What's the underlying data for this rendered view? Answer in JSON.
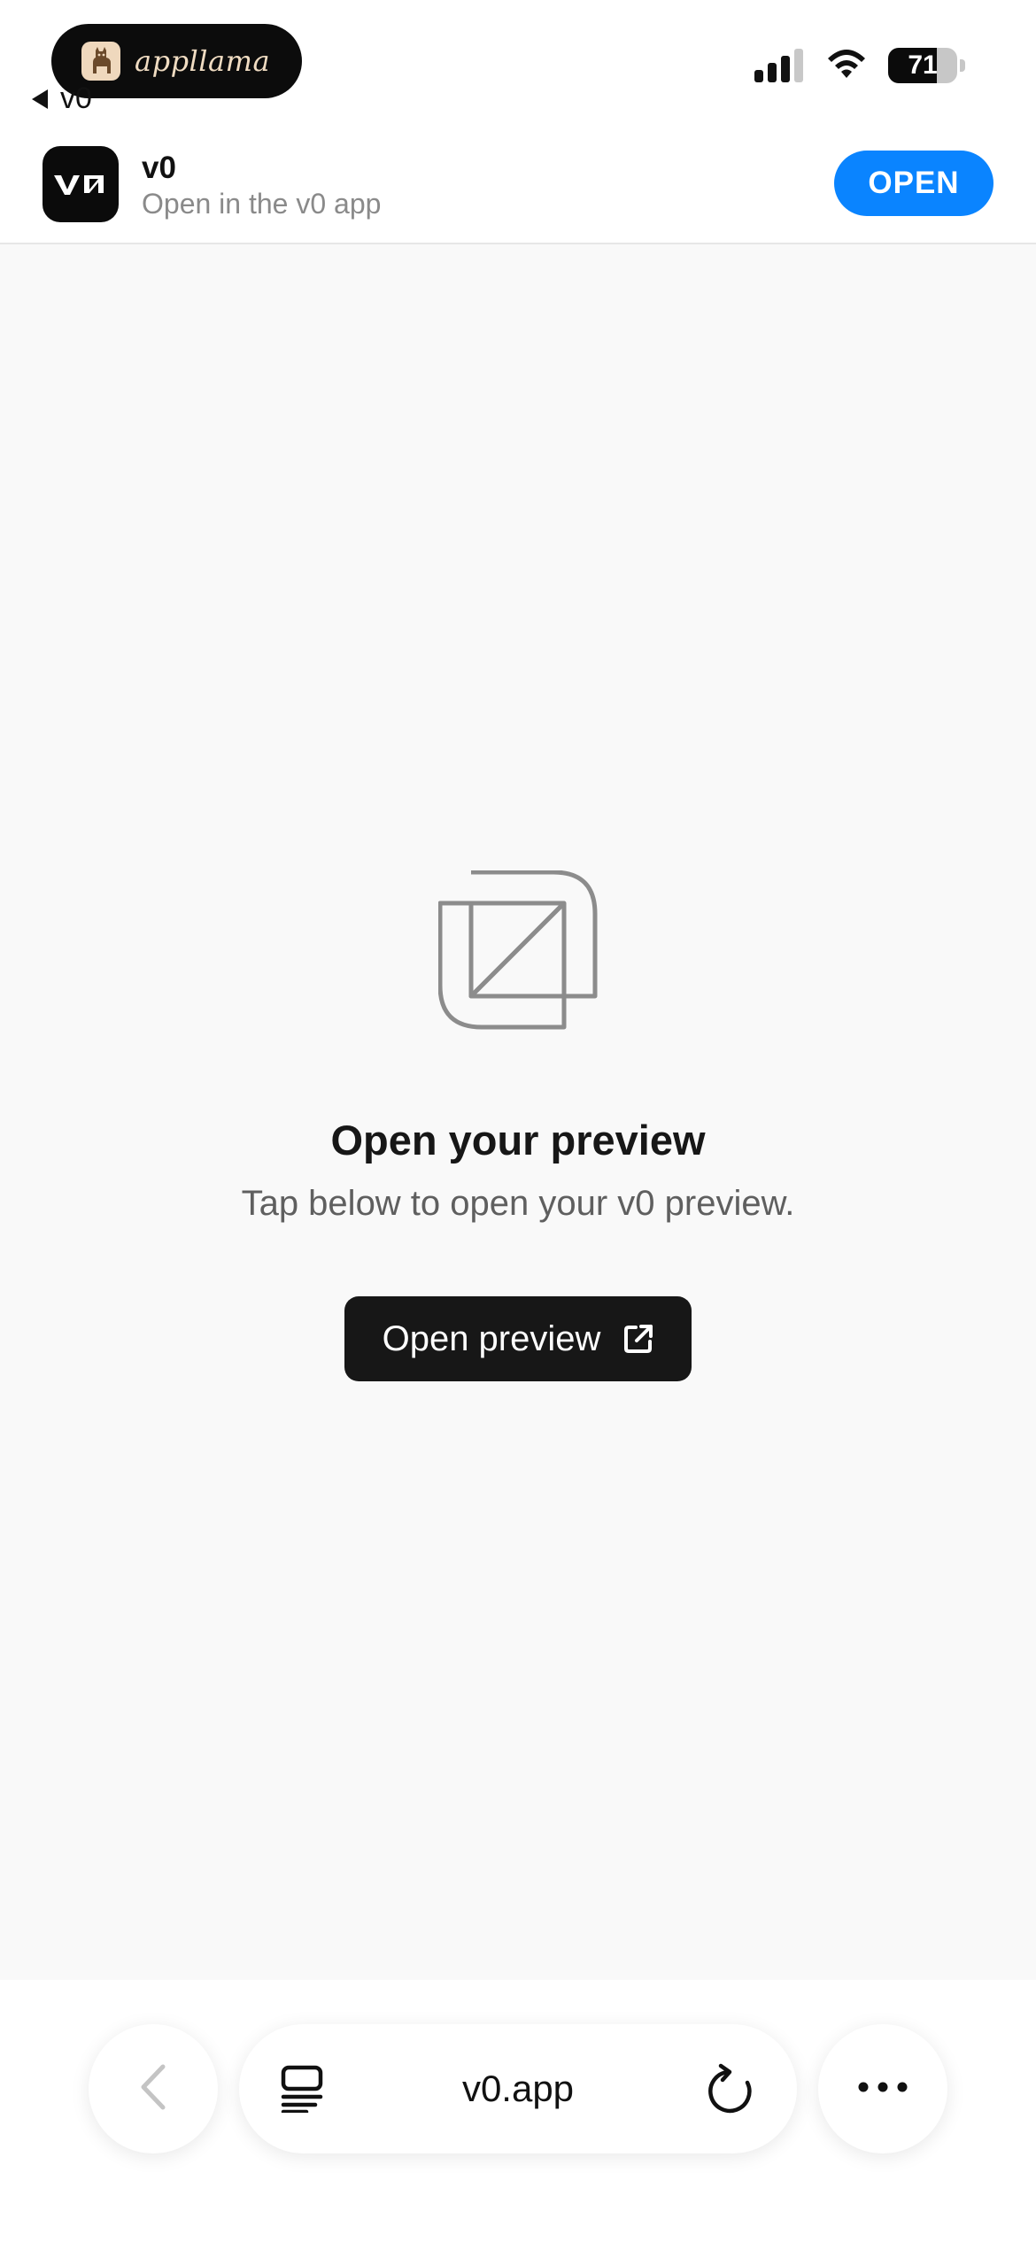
{
  "status_bar": {
    "pill_label": "appllama",
    "back_label": "v0",
    "battery_level": "71",
    "battery_fraction": 0.71
  },
  "app_banner": {
    "app_name": "v0",
    "subtitle": "Open in the v0 app",
    "open_label": "OPEN",
    "accent_color": "#0a84ff"
  },
  "main": {
    "icon": "preview-frame-icon",
    "heading": "Open your preview",
    "subtitle": "Tap below to open your v0 preview.",
    "button_label": "Open preview",
    "button_icon": "external-link-icon"
  },
  "browser_bar": {
    "url": "v0.app",
    "back_icon": "chevron-left-icon",
    "reader_icon": "reader-icon",
    "reload_icon": "reload-icon",
    "more_icon": "ellipsis-icon"
  }
}
